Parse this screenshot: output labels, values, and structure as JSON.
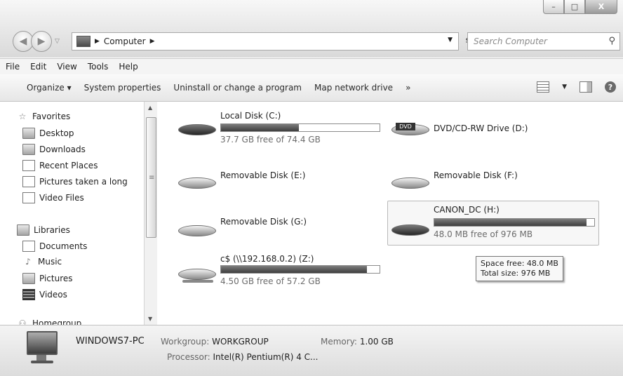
{
  "window": {
    "caption_buttons": {
      "minimize": "–",
      "maximize": "□",
      "close": "X"
    }
  },
  "navigation": {
    "back_icon": "back-arrow-icon",
    "forward_icon": "forward-arrow-icon"
  },
  "address_bar": {
    "crumb": "Computer"
  },
  "search": {
    "placeholder": "Search Computer"
  },
  "menu": [
    "File",
    "Edit",
    "View",
    "Tools",
    "Help"
  ],
  "toolbar": {
    "organize": "Organize ▾",
    "system_properties": "System properties",
    "uninstall": "Uninstall or change a program",
    "map_drive": "Map network drive",
    "more": "»"
  },
  "nav_pane": {
    "favorites_header": "Favorites",
    "favorites": [
      "Desktop",
      "Downloads",
      "Recent Places",
      "Pictures taken a long",
      "Video Files"
    ],
    "libraries_header": "Libraries",
    "libraries": [
      "Documents",
      "Music",
      "Pictures",
      "Videos"
    ],
    "homegroup": "Homegroup"
  },
  "drives": [
    {
      "label": "Local Disk (C:)",
      "free_text": "37.7 GB free of 74.4 GB",
      "used_fraction": 0.49
    },
    {
      "label": "DVD/CD-RW Drive (D:)"
    },
    {
      "label": "Removable Disk (E:)"
    },
    {
      "label": "Removable Disk (F:)"
    },
    {
      "label": "Removable Disk (G:)"
    },
    {
      "label": "CANON_DC (H:)",
      "free_text": "48.0 MB free of 976 MB",
      "used_fraction": 0.95
    },
    {
      "label": "c$ (\\\\192.168.0.2) (Z:)",
      "free_text": "4.50 GB free of 57.2 GB",
      "used_fraction": 0.92
    }
  ],
  "tooltip": {
    "line1": "Space free: 48.0 MB",
    "line2": "Total size: 976 MB"
  },
  "details": {
    "computer_name": "WINDOWS7-PC",
    "workgroup_label": "Workgroup:",
    "workgroup_value": "WORKGROUP",
    "memory_label": "Memory:",
    "memory_value": "1.00 GB",
    "processor_label": "Processor:",
    "processor_value": "Intel(R) Pentium(R) 4 C..."
  },
  "colors": {
    "bar_fill": "#4a4a4a",
    "background": "#ffffff"
  }
}
